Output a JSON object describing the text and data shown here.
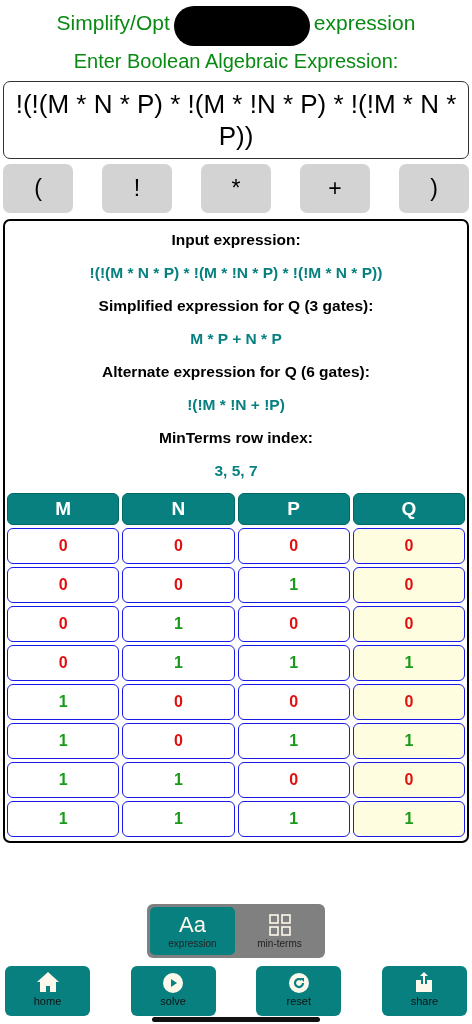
{
  "title": {
    "left": "Simplify/Opt",
    "right": "expression"
  },
  "prompt": "Enter Boolean Algebraic Expression:",
  "input": {
    "value": "!(!(M * N * P) * !(M * !N * P) * !(!M * N * P))"
  },
  "keys": [
    "(",
    "!",
    "*",
    "+",
    ")"
  ],
  "results": [
    {
      "kind": "heading",
      "text": "Input expression:"
    },
    {
      "kind": "value",
      "text": "!(!(M * N * P) * !(M * !N * P) * !(!M * N * P))"
    },
    {
      "kind": "heading",
      "text": "Simplified expression for Q (3 gates):"
    },
    {
      "kind": "value",
      "text": "M * P + N * P"
    },
    {
      "kind": "heading",
      "text": "Alternate expression for Q (6 gates):"
    },
    {
      "kind": "value",
      "text": "!(!M * !N + !P)"
    },
    {
      "kind": "heading",
      "text": "MinTerms row index:"
    },
    {
      "kind": "value",
      "text": "3, 5, 7"
    }
  ],
  "table": {
    "columns": [
      {
        "label": "M",
        "kind": "input"
      },
      {
        "label": "N",
        "kind": "input"
      },
      {
        "label": "P",
        "kind": "input"
      },
      {
        "label": "Q",
        "kind": "output"
      }
    ],
    "rows": [
      [
        {
          "value": "0",
          "on": false
        },
        {
          "value": "0",
          "on": false
        },
        {
          "value": "0",
          "on": false
        },
        {
          "value": "0",
          "on": false
        }
      ],
      [
        {
          "value": "0",
          "on": false
        },
        {
          "value": "0",
          "on": false
        },
        {
          "value": "1",
          "on": true
        },
        {
          "value": "0",
          "on": false
        }
      ],
      [
        {
          "value": "0",
          "on": false
        },
        {
          "value": "1",
          "on": true
        },
        {
          "value": "0",
          "on": false
        },
        {
          "value": "0",
          "on": false
        }
      ],
      [
        {
          "value": "0",
          "on": false
        },
        {
          "value": "1",
          "on": true
        },
        {
          "value": "1",
          "on": true
        },
        {
          "value": "1",
          "on": true
        }
      ],
      [
        {
          "value": "1",
          "on": true
        },
        {
          "value": "0",
          "on": false
        },
        {
          "value": "0",
          "on": false
        },
        {
          "value": "0",
          "on": false
        }
      ],
      [
        {
          "value": "1",
          "on": true
        },
        {
          "value": "0",
          "on": false
        },
        {
          "value": "1",
          "on": true
        },
        {
          "value": "1",
          "on": true
        }
      ],
      [
        {
          "value": "1",
          "on": true
        },
        {
          "value": "1",
          "on": true
        },
        {
          "value": "0",
          "on": false
        },
        {
          "value": "0",
          "on": false
        }
      ],
      [
        {
          "value": "1",
          "on": true
        },
        {
          "value": "1",
          "on": true
        },
        {
          "value": "1",
          "on": true
        },
        {
          "value": "1",
          "on": true
        }
      ]
    ]
  },
  "modes": [
    {
      "label": "expression",
      "kind": "text",
      "icon_text": "Aa",
      "selected": true
    },
    {
      "label": "min-terms",
      "kind": "grid",
      "selected": false
    }
  ],
  "actions": [
    {
      "label": "home",
      "kind": "home"
    },
    {
      "label": "solve",
      "kind": "play"
    },
    {
      "label": "reset",
      "kind": "reset"
    },
    {
      "label": "share",
      "kind": "share"
    }
  ]
}
